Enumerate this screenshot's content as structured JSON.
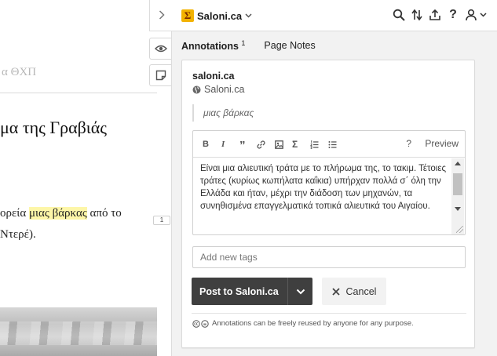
{
  "page": {
    "header_fragment": "α ΘΧΠ",
    "title_fragment": "μα της Γραβιάς",
    "line1_before": "ορεία ",
    "line1_highlight": "μιας βάρκας",
    "line1_after": " από το",
    "line2": "Ντερέ)."
  },
  "anchor": {
    "count": "1"
  },
  "topbar": {
    "group_name": "Saloni.ca",
    "group_logo_glyph": "Σ",
    "icons": [
      "search-icon",
      "sort-icon",
      "share-icon",
      "help-icon",
      "user-icon"
    ],
    "help_glyph": "?"
  },
  "tabs": {
    "annotations_label": "Annotations",
    "annotations_count": "1",
    "page_notes_label": "Page Notes"
  },
  "card": {
    "user": "saloni.ca",
    "group": "Saloni.ca",
    "quote": "μιας βάρκας",
    "editor": {
      "toolbar": {
        "bold": "B",
        "italic": "I",
        "quote": "”",
        "math": "Σ",
        "help": "?",
        "preview": "Preview"
      },
      "text": "Είναι μια αλιευτική τράτα με το πλήρωμα της, το τακιμ. Τέτοιες τράτες (κυρίως κωπήλατα καΐκια) υπήρχαν πολλά σ΄ όλη την Ελλάδα και ήταν, μέχρι την διάδοση των μηχανών, τα συνηθισμένα επαγγελματικά τοπικά αλιευτικά του Αιγαίου."
    },
    "tags_placeholder": "Add new tags",
    "post_label": "Post to Saloni.ca",
    "cancel_label": "Cancel",
    "license_text": "Annotations can be freely reused by anyone for any purpose."
  },
  "colors": {
    "highlight": "#fdf6a8",
    "post_button": "#3f3f3f",
    "group_logo": "#f2b200"
  }
}
